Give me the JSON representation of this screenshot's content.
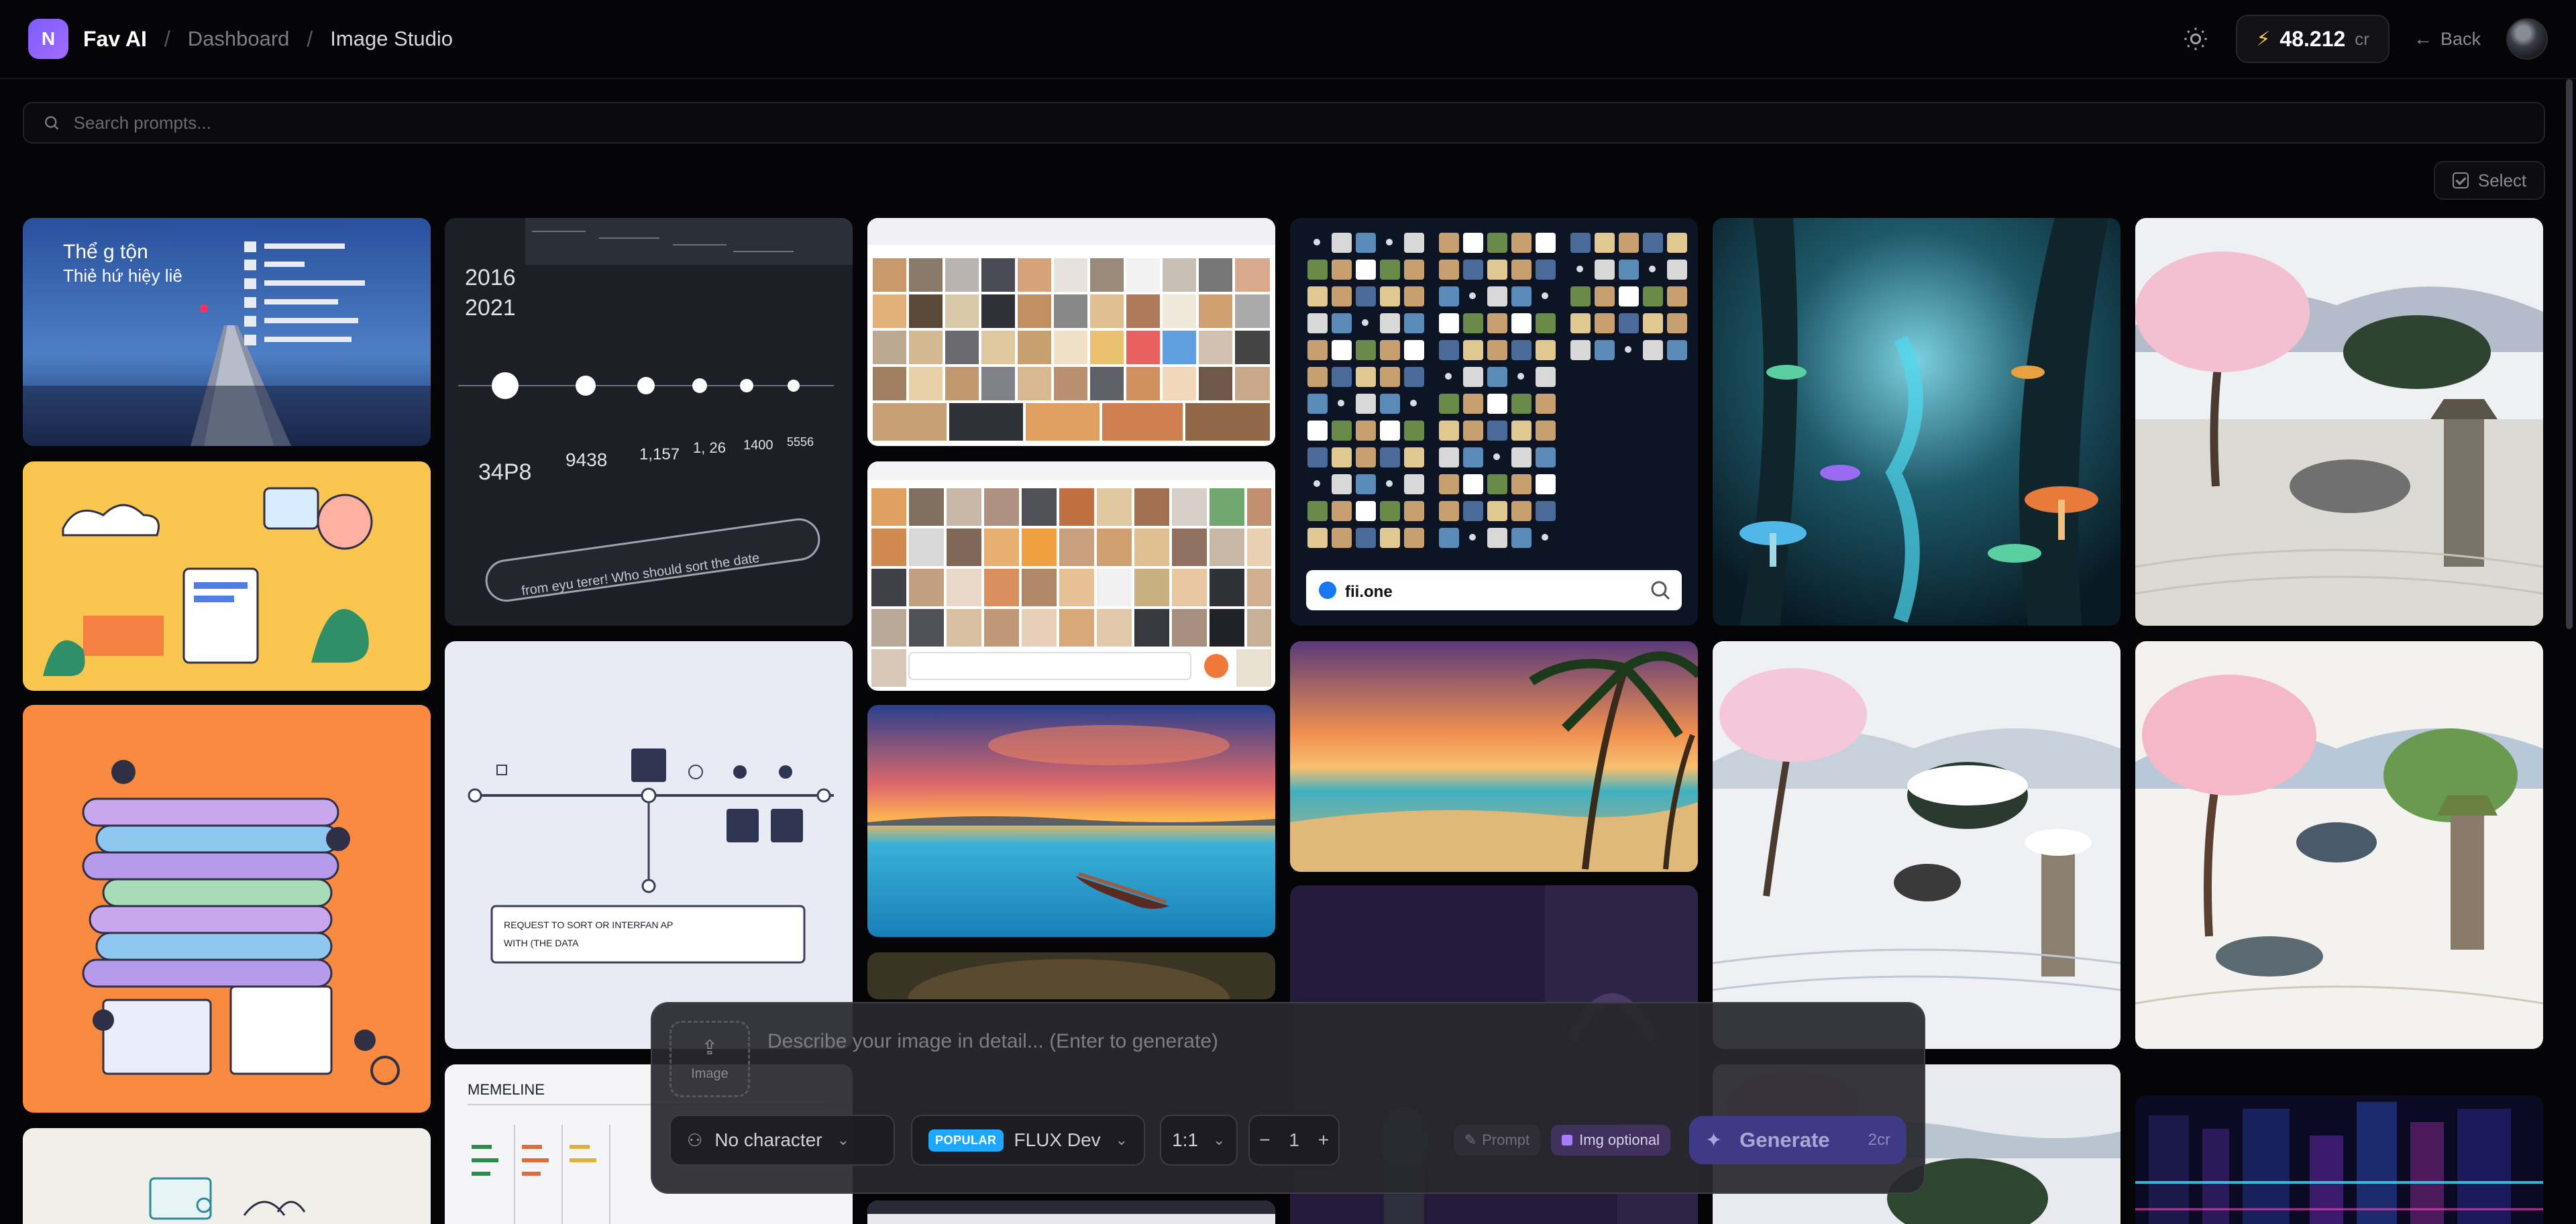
{
  "app": {
    "logo_letter": "N",
    "name": "Fav AI"
  },
  "breadcrumb": {
    "items": [
      "Dashboard",
      "Image Studio"
    ]
  },
  "header": {
    "credits": "48.212",
    "credits_unit": "cr",
    "back_label": "Back"
  },
  "search": {
    "placeholder": "Search prompts..."
  },
  "toolbar": {
    "select_label": "Select"
  },
  "gallery": {
    "items": [
      {
        "id": "poster-bridge-sunset"
      },
      {
        "id": "dashboard-dates-tags"
      },
      {
        "id": "photo-grid-ui"
      },
      {
        "id": "icon-grid-search"
      },
      {
        "id": "enchanted-mushroom-forest"
      },
      {
        "id": "zen-garden-cherry"
      },
      {
        "id": "flat-illustration-team"
      },
      {
        "id": "photo-grid-ui-2"
      },
      {
        "id": "timeline-diagram"
      },
      {
        "id": "lake-boat-sunset"
      },
      {
        "id": "tropical-beach"
      },
      {
        "id": "zen-garden-snow"
      },
      {
        "id": "zen-garden-watercolor"
      },
      {
        "id": "colorful-stacked-illustration"
      },
      {
        "id": "golden-retriever"
      },
      {
        "id": "knight-armor"
      },
      {
        "id": "memeline-doc"
      },
      {
        "id": "zen-garden-small"
      },
      {
        "id": "cyber-city"
      },
      {
        "id": "table-doc"
      },
      {
        "id": "illustration-light"
      }
    ],
    "icon_grid_search_text": "fii.one",
    "dashboard_years": [
      "2016",
      "2021"
    ],
    "dashboard_values": [
      "34P8",
      "9438",
      "1,157",
      "1, 26",
      "1400",
      "5556"
    ],
    "dashboard_prompt": "from eyu terer! Who should sort the date",
    "timeline_box_text": [
      "REQUEST TO SORT OR INTERFAN AP",
      "WITH (THE DATA"
    ],
    "poster_title": "Thể g tộn",
    "poster_subtitle": "Thiẻ hứ hiệy liê",
    "memeline_title": "MEMELINE"
  },
  "composer": {
    "upload_label": "Image",
    "prompt_placeholder": "Describe your image in detail... (Enter to generate)",
    "character_label": "No character",
    "model_badge": "POPULAR",
    "model_label": "FLUX Dev",
    "ratio_label": "1:1",
    "count_value": "1",
    "prompt_chip": "Prompt",
    "img_chip": "Img optional",
    "generate_label": "Generate",
    "generate_cost": "2cr"
  },
  "colors": {
    "accent": "#7c5cff",
    "popular_badge": "#1ea7ff",
    "generate_bg": "#3e3a86",
    "credit_bolt": "#f7c948"
  }
}
